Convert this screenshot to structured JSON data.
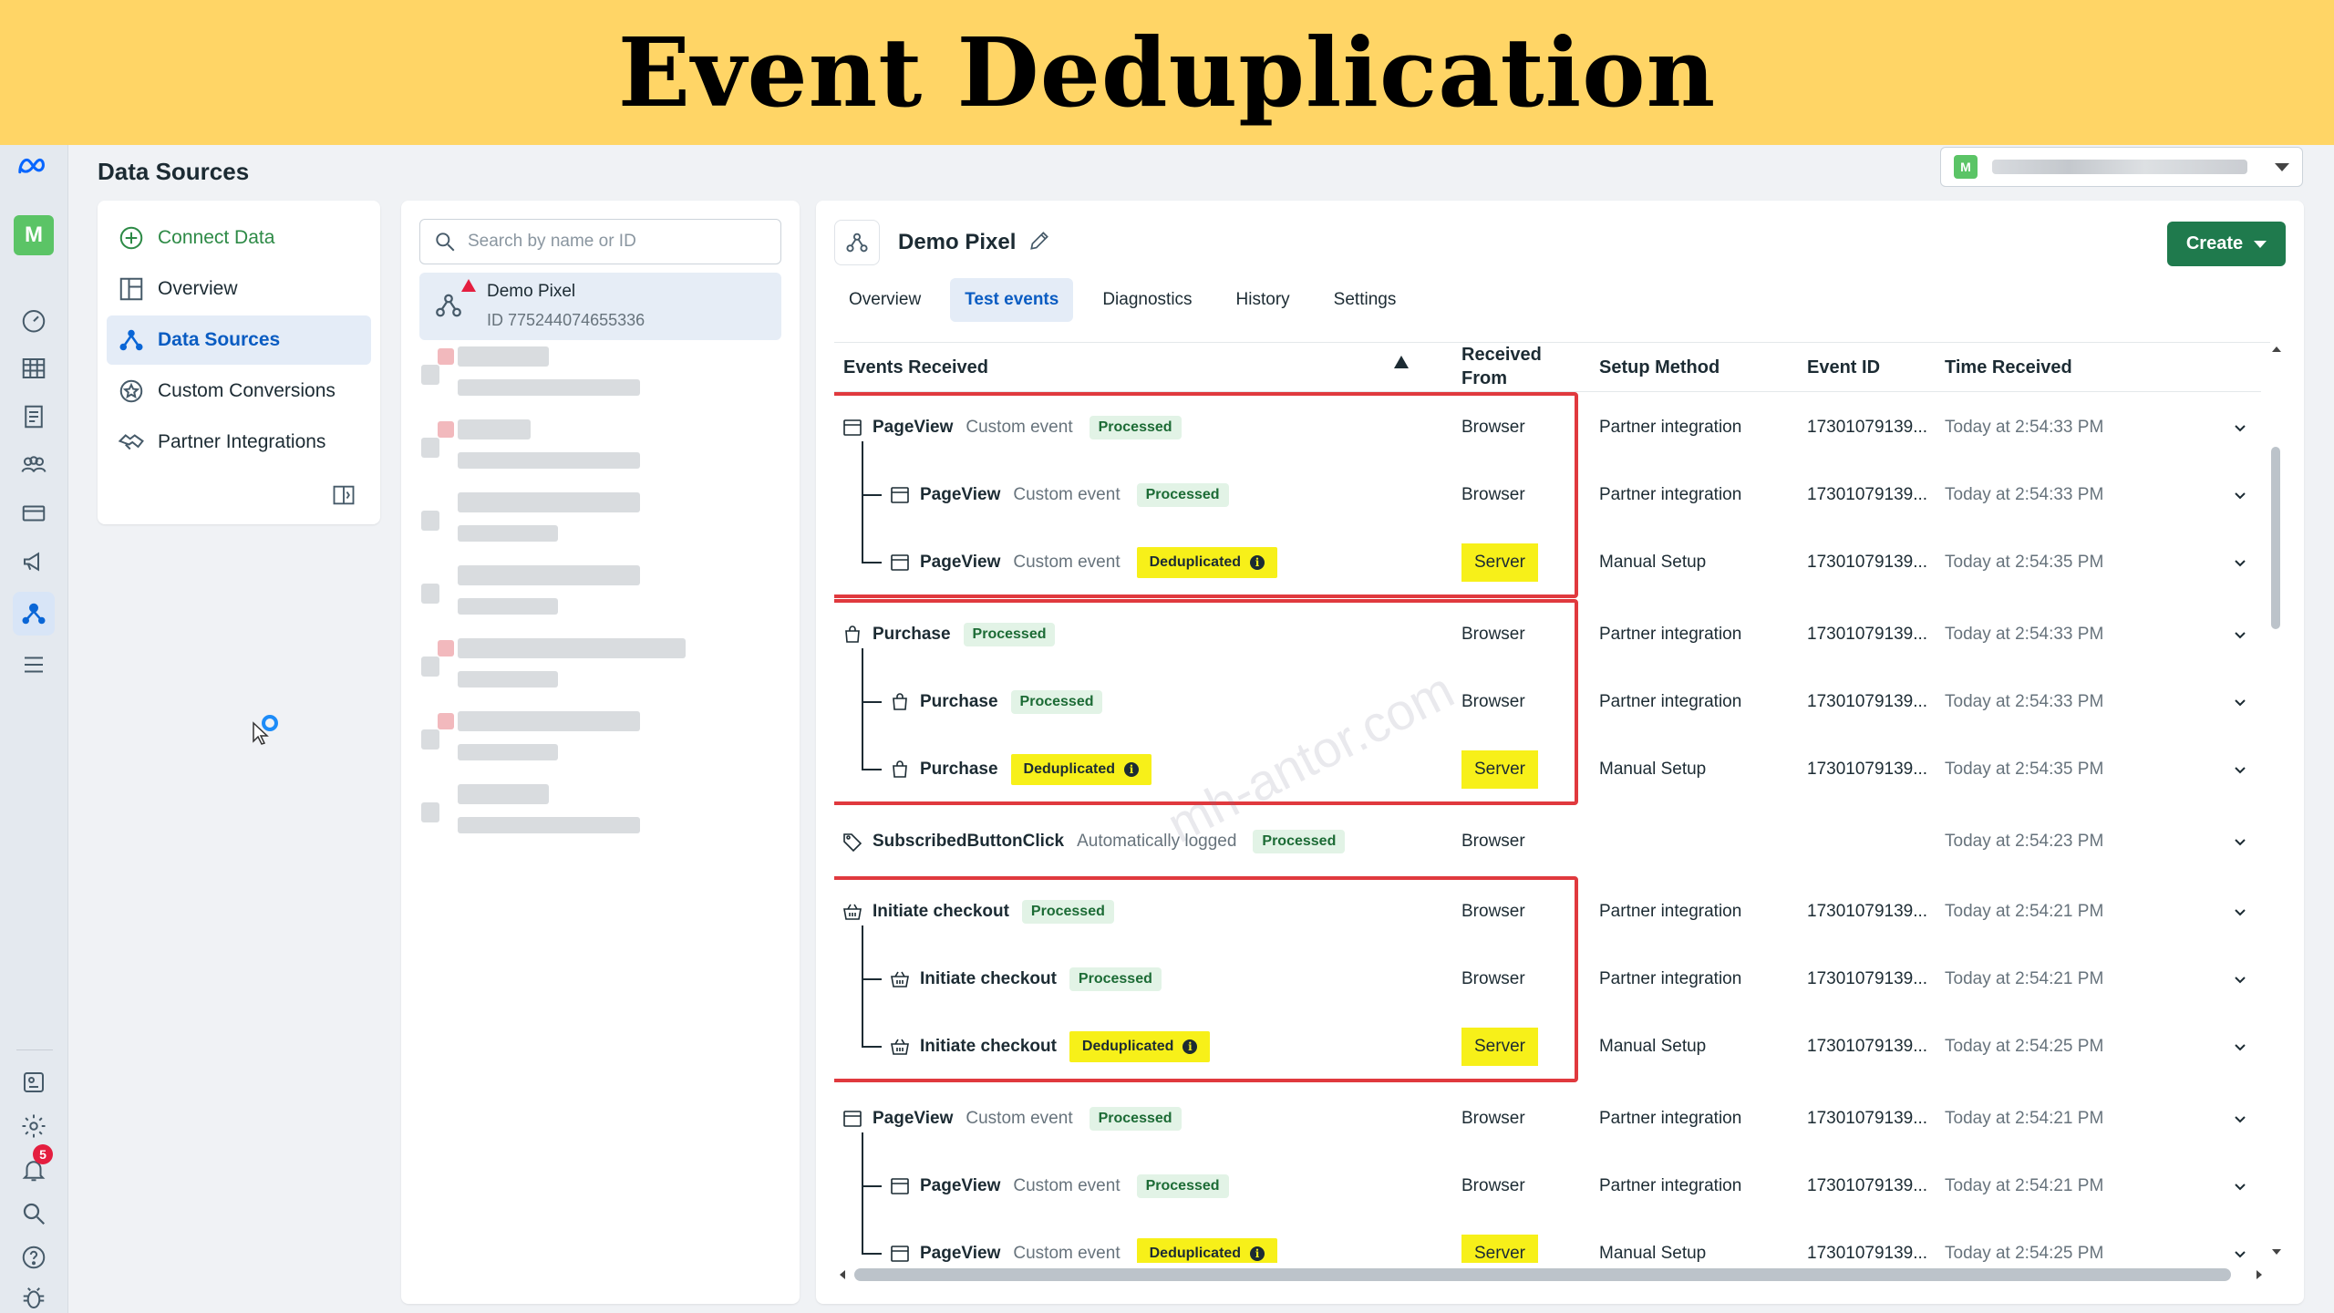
{
  "banner": {
    "title": "Event Deduplication"
  },
  "rail": {
    "avatar_letter": "M",
    "notification_count": "5"
  },
  "header": {
    "page_title": "Data Sources",
    "account_avatar": "M"
  },
  "nav": {
    "items": [
      {
        "label": "Connect Data",
        "icon": "plus-circle-icon"
      },
      {
        "label": "Overview",
        "icon": "layout-icon"
      },
      {
        "label": "Data Sources",
        "icon": "data-sources-icon",
        "active": true
      },
      {
        "label": "Custom Conversions",
        "icon": "star-badge-icon"
      },
      {
        "label": "Partner Integrations",
        "icon": "handshake-icon"
      }
    ]
  },
  "list": {
    "search_placeholder": "Search by name or ID",
    "selected_pixel": {
      "name": "Demo Pixel",
      "id": "ID 775244074655336"
    }
  },
  "detail": {
    "pixel_title": "Demo Pixel",
    "create_label": "Create",
    "tabs": [
      "Overview",
      "Test events",
      "Diagnostics",
      "History",
      "Settings"
    ],
    "active_tab": "Test events"
  },
  "table": {
    "headers": {
      "events": "Events Received",
      "received_from_1": "Received",
      "received_from_2": "From",
      "setup": "Setup Method",
      "event_id": "Event ID",
      "time": "Time Received"
    },
    "rows": [
      {
        "name": "PageView",
        "sub": "Custom event",
        "status": "Processed",
        "from": "Browser",
        "setup": "Partner integration",
        "event_id": "17301079139...",
        "time": "Today at 2:54:33 PM"
      },
      {
        "name": "PageView",
        "sub": "Custom event",
        "status": "Processed",
        "from": "Browser",
        "setup": "Partner integration",
        "event_id": "17301079139...",
        "time": "Today at 2:54:33 PM"
      },
      {
        "name": "PageView",
        "sub": "Custom event",
        "status": "Deduplicated",
        "from": "Server",
        "setup": "Manual Setup",
        "event_id": "17301079139...",
        "time": "Today at 2:54:35 PM"
      },
      {
        "name": "Purchase",
        "sub": "",
        "status": "Processed",
        "from": "Browser",
        "setup": "Partner integration",
        "event_id": "17301079139...",
        "time": "Today at 2:54:33 PM"
      },
      {
        "name": "Purchase",
        "sub": "",
        "status": "Processed",
        "from": "Browser",
        "setup": "Partner integration",
        "event_id": "17301079139...",
        "time": "Today at 2:54:33 PM"
      },
      {
        "name": "Purchase",
        "sub": "",
        "status": "Deduplicated",
        "from": "Server",
        "setup": "Manual Setup",
        "event_id": "17301079139...",
        "time": "Today at 2:54:35 PM"
      },
      {
        "name": "SubscribedButtonClick",
        "sub": "Automatically logged",
        "status": "Processed",
        "from": "Browser",
        "setup": "",
        "event_id": "",
        "time": "Today at 2:54:23 PM"
      },
      {
        "name": "Initiate checkout",
        "sub": "",
        "status": "Processed",
        "from": "Browser",
        "setup": "Partner integration",
        "event_id": "17301079139...",
        "time": "Today at 2:54:21 PM"
      },
      {
        "name": "Initiate checkout",
        "sub": "",
        "status": "Processed",
        "from": "Browser",
        "setup": "Partner integration",
        "event_id": "17301079139...",
        "time": "Today at 2:54:21 PM"
      },
      {
        "name": "Initiate checkout",
        "sub": "",
        "status": "Deduplicated",
        "from": "Server",
        "setup": "Manual Setup",
        "event_id": "17301079139...",
        "time": "Today at 2:54:25 PM"
      },
      {
        "name": "PageView",
        "sub": "Custom event",
        "status": "Processed",
        "from": "Browser",
        "setup": "Partner integration",
        "event_id": "17301079139...",
        "time": "Today at 2:54:21 PM"
      },
      {
        "name": "PageView",
        "sub": "Custom event",
        "status": "Processed",
        "from": "Browser",
        "setup": "Partner integration",
        "event_id": "17301079139...",
        "time": "Today at 2:54:21 PM"
      },
      {
        "name": "PageView",
        "sub": "Custom event",
        "status": "Deduplicated",
        "from": "Server",
        "setup": "Manual Setup",
        "event_id": "17301079139...",
        "time": "Today at 2:54:25 PM"
      }
    ]
  },
  "watermark": "mh-antor.com"
}
